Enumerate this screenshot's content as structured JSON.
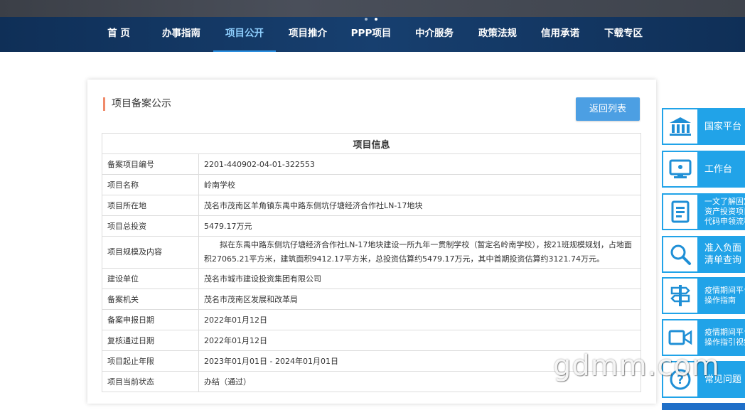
{
  "nav": {
    "items": [
      "首 页",
      "办事指南",
      "项目公开",
      "项目推介",
      "PPP项目",
      "中介服务",
      "政策法规",
      "信用承诺",
      "下载专区"
    ],
    "active": "项目公开"
  },
  "panel": {
    "title": "项目备案公示",
    "back_label": "返回列表",
    "table_header": "项目信息",
    "rows": [
      {
        "label": "备案项目编号",
        "value": "2201-440902-04-01-322553"
      },
      {
        "label": "项目名称",
        "value": "岭南学校"
      },
      {
        "label": "项目所在地",
        "value": "茂名市茂南区羊角镇东禹中路东侧坑仔塘经济合作社LN-17地块"
      },
      {
        "label": "项目总投资",
        "value": "5479.17万元"
      },
      {
        "label": "项目规模及内容",
        "value": "拟在东禹中路东侧坑仔塘经济合作社LN-17地块建设一所九年一贯制学校（暂定名岭南学校），按21班规模规划，占地面积27065.21平方米，建筑面积9412.17平方米，总投资估算约5479.17万元，其中首期投资估算约3121.74万元。"
      },
      {
        "label": "建设单位",
        "value": "茂名市城市建设投资集团有限公司"
      },
      {
        "label": "备案机关",
        "value": "茂名市茂南区发展和改革局"
      },
      {
        "label": "备案申报日期",
        "value": "2022年01月12日"
      },
      {
        "label": "复核通过日期",
        "value": "2022年01月12日"
      },
      {
        "label": "项目起止年限",
        "value": "2023年01月01日 - 2024年01月01日"
      },
      {
        "label": "项目当前状态",
        "value": "办结（通过）"
      }
    ]
  },
  "sidebar": {
    "items": [
      {
        "label": "国家平台",
        "icon": "bank-icon"
      },
      {
        "label": "工作台",
        "icon": "computer-icon"
      },
      {
        "label": "一文了解固定\n资产投资项目\n代码申领流程",
        "icon": "document-icon"
      },
      {
        "label": "准入负面\n清单查询",
        "icon": "magnifier-icon"
      },
      {
        "label": "疫情期间平台\n操作指南",
        "icon": "signpost-icon"
      },
      {
        "label": "疫情期间平台\n操作指引视频",
        "icon": "video-icon"
      },
      {
        "label": "常见问题",
        "icon": "question-icon"
      }
    ]
  },
  "watermark": "gdmm.com",
  "colors": {
    "nav_bg": "#173f6f",
    "accent": "#4c9fe3",
    "side_bg": "#21a3e8",
    "title_bar": "#f08a6a"
  }
}
